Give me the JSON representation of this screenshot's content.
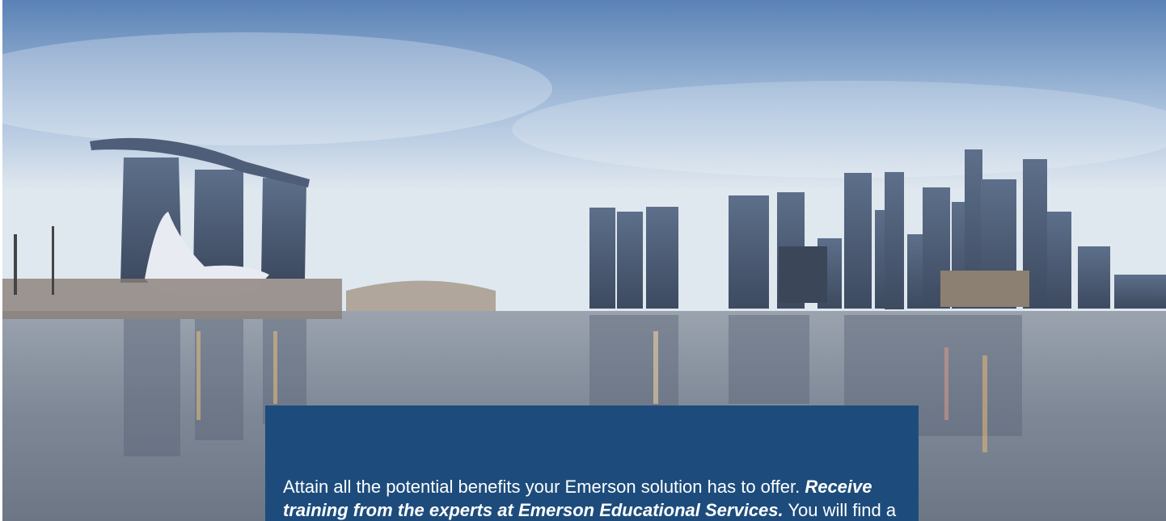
{
  "hero": {
    "image": "Singapore Marina Bay skyline at dusk reflected in water"
  },
  "intro": {
    "text_1": "Attain all the potential benefits your Emerson solution has to offer.  ",
    "text_2_emphasis": "Receive training from the experts at Emerson Educational Services.",
    "text_3": "  You will find a sustainable, competitive"
  },
  "colors": {
    "panel": "#1d4c7c",
    "text": "#ffffff"
  }
}
